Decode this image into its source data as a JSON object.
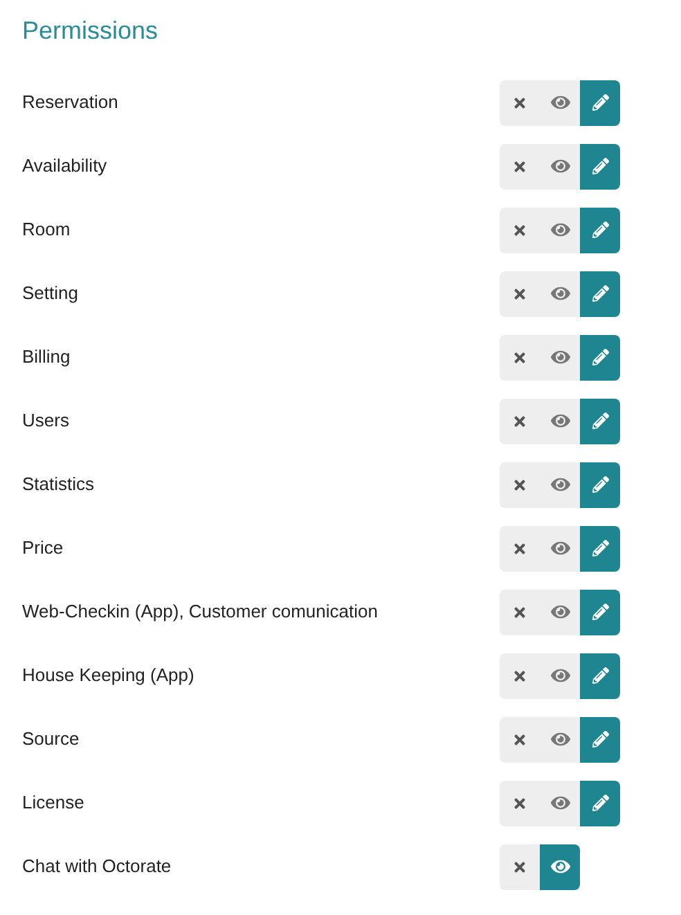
{
  "title": "Permissions",
  "permissions": [
    {
      "label": "Reservation",
      "options": [
        {
          "kind": "none",
          "selected": false
        },
        {
          "kind": "read",
          "selected": false
        },
        {
          "kind": "write",
          "selected": true
        }
      ]
    },
    {
      "label": "Availability",
      "options": [
        {
          "kind": "none",
          "selected": false
        },
        {
          "kind": "read",
          "selected": false
        },
        {
          "kind": "write",
          "selected": true
        }
      ]
    },
    {
      "label": "Room",
      "options": [
        {
          "kind": "none",
          "selected": false
        },
        {
          "kind": "read",
          "selected": false
        },
        {
          "kind": "write",
          "selected": true
        }
      ]
    },
    {
      "label": "Setting",
      "options": [
        {
          "kind": "none",
          "selected": false
        },
        {
          "kind": "read",
          "selected": false
        },
        {
          "kind": "write",
          "selected": true
        }
      ]
    },
    {
      "label": "Billing",
      "options": [
        {
          "kind": "none",
          "selected": false
        },
        {
          "kind": "read",
          "selected": false
        },
        {
          "kind": "write",
          "selected": true
        }
      ]
    },
    {
      "label": "Users",
      "options": [
        {
          "kind": "none",
          "selected": false
        },
        {
          "kind": "read",
          "selected": false
        },
        {
          "kind": "write",
          "selected": true
        }
      ]
    },
    {
      "label": "Statistics",
      "options": [
        {
          "kind": "none",
          "selected": false
        },
        {
          "kind": "read",
          "selected": false
        },
        {
          "kind": "write",
          "selected": true
        }
      ]
    },
    {
      "label": "Price",
      "options": [
        {
          "kind": "none",
          "selected": false
        },
        {
          "kind": "read",
          "selected": false
        },
        {
          "kind": "write",
          "selected": true
        }
      ]
    },
    {
      "label": "Web-Checkin (App), Customer comunication",
      "options": [
        {
          "kind": "none",
          "selected": false
        },
        {
          "kind": "read",
          "selected": false
        },
        {
          "kind": "write",
          "selected": true
        }
      ]
    },
    {
      "label": "House Keeping (App)",
      "options": [
        {
          "kind": "none",
          "selected": false
        },
        {
          "kind": "read",
          "selected": false
        },
        {
          "kind": "write",
          "selected": true
        }
      ]
    },
    {
      "label": "Source",
      "options": [
        {
          "kind": "none",
          "selected": false
        },
        {
          "kind": "read",
          "selected": false
        },
        {
          "kind": "write",
          "selected": true
        }
      ]
    },
    {
      "label": "License",
      "options": [
        {
          "kind": "none",
          "selected": false
        },
        {
          "kind": "read",
          "selected": false
        },
        {
          "kind": "write",
          "selected": true
        }
      ]
    },
    {
      "label": "Chat with Octorate",
      "options": [
        {
          "kind": "none",
          "selected": false
        },
        {
          "kind": "read",
          "selected": true
        }
      ]
    }
  ]
}
